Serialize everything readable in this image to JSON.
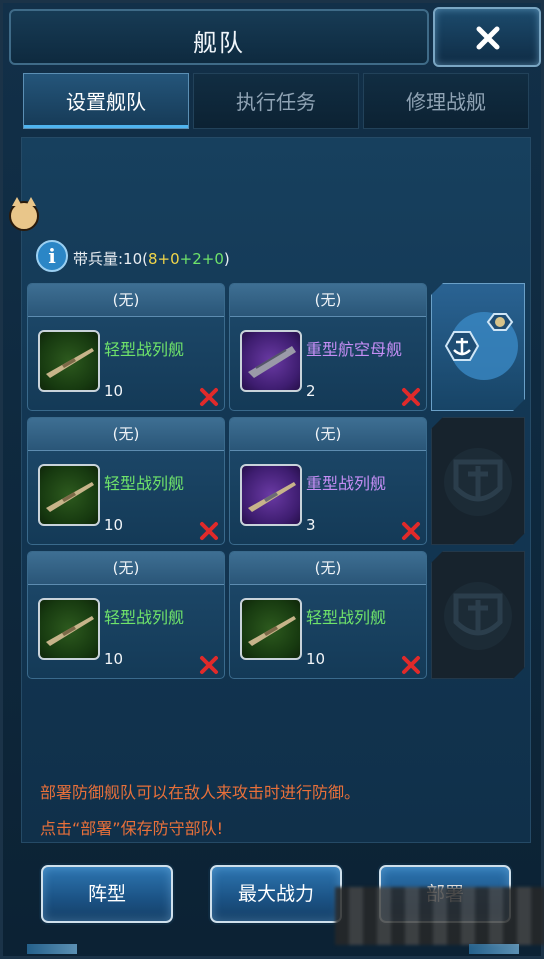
{
  "header": {
    "title": "舰队"
  },
  "tabs": [
    {
      "label": "设置舰队",
      "active": true
    },
    {
      "label": "执行任务",
      "active": false
    },
    {
      "label": "修理战舰",
      "active": false
    }
  ],
  "troops": {
    "prefix": "带兵量:10(",
    "a": "8",
    "plus1": "+",
    "b": "0",
    "plus2": "+",
    "c": "2",
    "plus3": "+",
    "d": "0",
    "suffix": ")"
  },
  "fleet": [
    {
      "formation": "(无)",
      "name": "轻型战列舰",
      "count": "10",
      "color": "green"
    },
    {
      "formation": "(无)",
      "name": "重型航空母舰",
      "count": "2",
      "color": "purple"
    },
    {
      "formation": "(无)",
      "name": "轻型战列舰",
      "count": "10",
      "color": "green"
    },
    {
      "formation": "(无)",
      "name": "重型战列舰",
      "count": "3",
      "color": "purple"
    },
    {
      "formation": "(无)",
      "name": "轻型战列舰",
      "count": "10",
      "color": "green"
    },
    {
      "formation": "(无)",
      "name": "轻型战列舰",
      "count": "10",
      "color": "green"
    }
  ],
  "side_slots": [
    {
      "icon": "anchor-admiral-icon",
      "active": true
    },
    {
      "icon": "anchor-shield-icon",
      "active": false
    },
    {
      "icon": "anchor-shield-icon",
      "active": false
    }
  ],
  "notes": {
    "line1": "部署防御舰队可以在敌人来攻击时进行防御。",
    "line2": "点击“部署”保存防守部队!"
  },
  "buttons": {
    "formation": "阵型",
    "max_power": "最大战力",
    "deploy": "部署"
  },
  "colors": {
    "green_ship": "#6fe36a",
    "purple_ship": "#c58ef5",
    "note": "#e8703a",
    "remove": "#e02a2a"
  }
}
